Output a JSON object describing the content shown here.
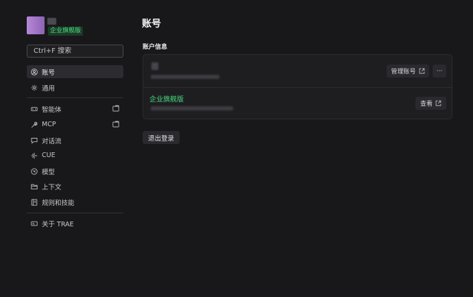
{
  "user": {
    "plan_badge": "企业旗舰版"
  },
  "search": {
    "placeholder": "Ctrl+F 搜索"
  },
  "sidebar": {
    "items": [
      {
        "label": "账号",
        "icon": "user-circle-icon",
        "active": true
      },
      {
        "label": "通用",
        "icon": "gear-icon"
      },
      {
        "label": "智能体",
        "icon": "gamepad-icon",
        "external": true
      },
      {
        "label": "MCP",
        "icon": "wrench-icon",
        "external": true
      },
      {
        "label": "对话流",
        "icon": "chat-icon"
      },
      {
        "label": "CUE",
        "icon": "cue-icon"
      },
      {
        "label": "模型",
        "icon": "model-icon"
      },
      {
        "label": "上下文",
        "icon": "folder-icon"
      },
      {
        "label": "规则和技能",
        "icon": "book-icon"
      },
      {
        "label": "关于 TRAE",
        "icon": "info-card-icon"
      }
    ]
  },
  "main": {
    "title": "账号",
    "section_label": "账户信息",
    "manage_button": "管理账号",
    "more_button": "···",
    "plan_name": "企业旗舰版",
    "view_button": "查看",
    "logout_button": "退出登录"
  },
  "colors": {
    "background": "#18181b",
    "card": "#1e1e21",
    "accent_green": "#4ade80",
    "active_item": "#2c2c30"
  }
}
